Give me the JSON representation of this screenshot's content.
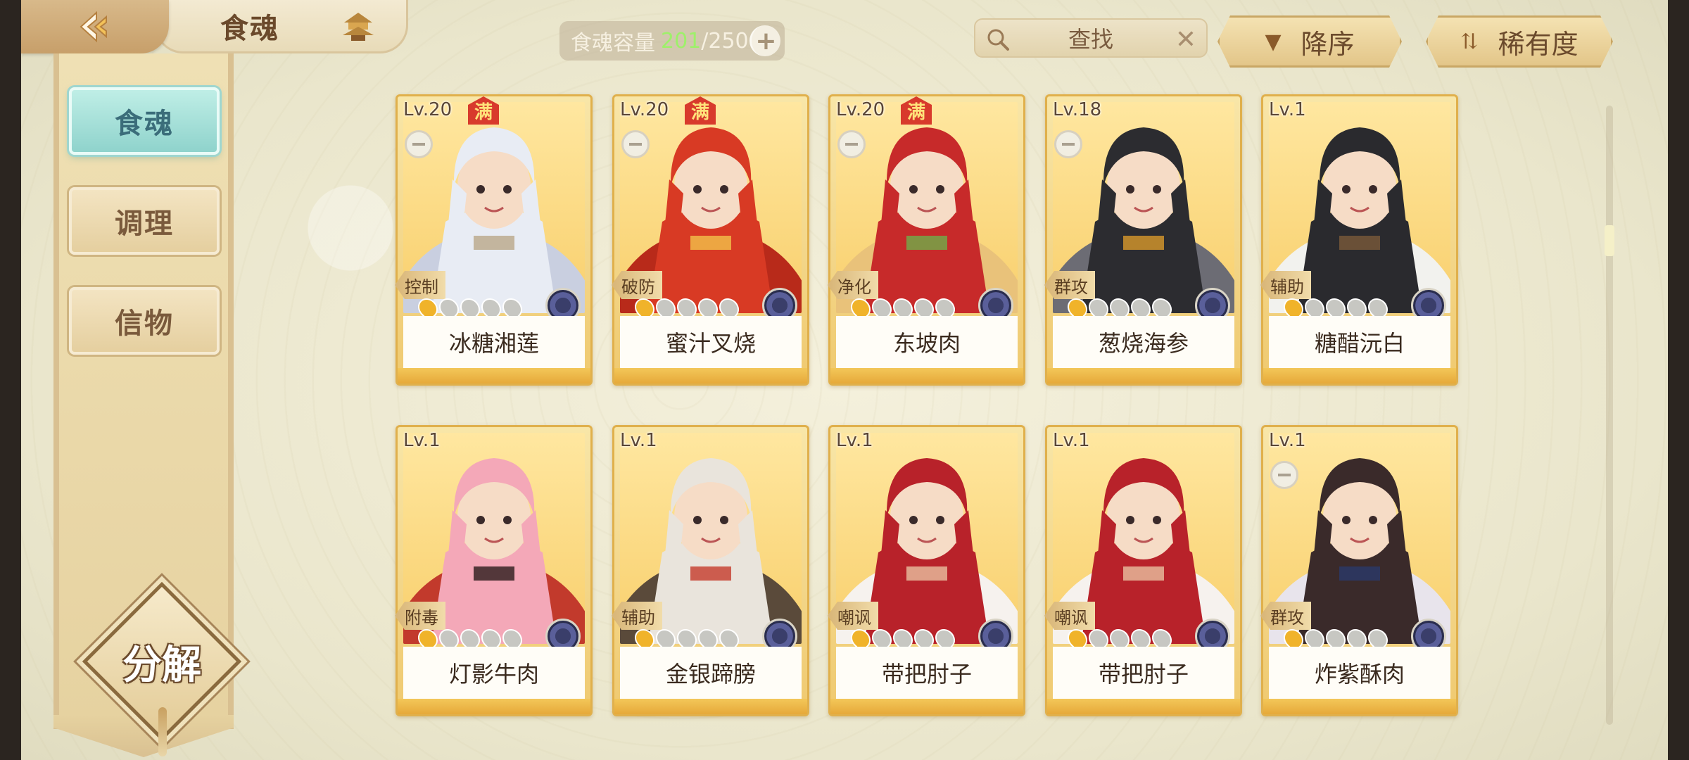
{
  "header": {
    "title": "食魂",
    "capacity_label": "食魂容量",
    "capacity_current": "201",
    "capacity_max": "/250",
    "search_label": "查找",
    "sort_order_label": "降序",
    "sort_rarity_label": "稀有度"
  },
  "sidebar": {
    "tabs": [
      {
        "label": "食魂",
        "active": true
      },
      {
        "label": "调理",
        "active": false
      },
      {
        "label": "信物",
        "active": false
      }
    ],
    "decompose_label": "分解"
  },
  "cards": [
    {
      "level": "Lv.20",
      "max": "满",
      "role": "控制",
      "name": "冰糖湘莲",
      "flames_on": 1,
      "palette": [
        "#e8ecf4",
        "#c9cfe0",
        "#b9a888"
      ]
    },
    {
      "level": "Lv.20",
      "max": "满",
      "role": "破防",
      "name": "蜜汁叉烧",
      "flames_on": 1,
      "palette": [
        "#d83a24",
        "#b82a1a",
        "#f2c24a"
      ]
    },
    {
      "level": "Lv.20",
      "max": "满",
      "role": "净化",
      "name": "东坡肉",
      "flames_on": 1,
      "palette": [
        "#c72a2a",
        "#e9c27a",
        "#6fae4a"
      ]
    },
    {
      "level": "Lv.18",
      "max": "",
      "role": "群攻",
      "name": "葱烧海参",
      "flames_on": 1,
      "palette": [
        "#2c2c30",
        "#6c6c74",
        "#d99a2c"
      ]
    },
    {
      "level": "Lv.1",
      "max": "",
      "role": "辅助",
      "name": "糖醋沅白",
      "flames_on": 1,
      "palette": [
        "#2a2a2e",
        "#f2f2ee",
        "#7a5a3a"
      ]
    },
    {
      "level": "Lv.1",
      "max": "",
      "role": "附毒",
      "name": "灯影牛肉",
      "flames_on": 1,
      "palette": [
        "#f4a8b8",
        "#c23a2c",
        "#2a1a1a"
      ]
    },
    {
      "level": "Lv.1",
      "max": "",
      "role": "辅助",
      "name": "金银蹄膀",
      "flames_on": 1,
      "palette": [
        "#e9e4dc",
        "#5a4a3a",
        "#c43a2a"
      ]
    },
    {
      "level": "Lv.1",
      "max": "",
      "role": "嘲讽",
      "name": "带把肘子",
      "flames_on": 1,
      "palette": [
        "#b8222a",
        "#f6f2ee",
        "#e8c0a0"
      ]
    },
    {
      "level": "Lv.1",
      "max": "",
      "role": "嘲讽",
      "name": "带把肘子",
      "flames_on": 1,
      "palette": [
        "#b8222a",
        "#f6f2ee",
        "#e8c0a0"
      ]
    },
    {
      "level": "Lv.1",
      "max": "",
      "role": "群攻",
      "name": "炸紫酥肉",
      "flames_on": 1,
      "palette": [
        "#3a2a2a",
        "#e8e4ec",
        "#2a3a6a"
      ]
    }
  ]
}
